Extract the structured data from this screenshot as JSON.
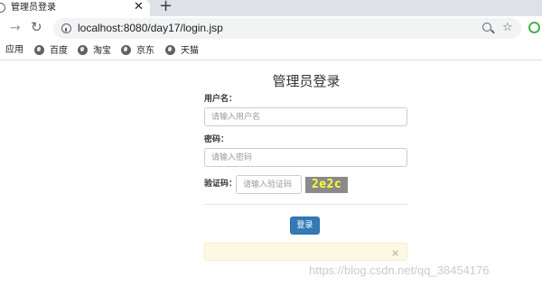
{
  "browser": {
    "tab_title": "管理员登录",
    "tab_close": "✕",
    "new_tab": "+",
    "forward_glyph": "→",
    "reload_glyph": "↻",
    "star_glyph": "☆",
    "url": "localhost:8080/day17/login.jsp",
    "bookmarks": [
      {
        "label": "应用",
        "icon": ""
      },
      {
        "label": "百度",
        "icon": "globe-icon"
      },
      {
        "label": "淘宝",
        "icon": "globe-icon"
      },
      {
        "label": "京东",
        "icon": "globe-icon"
      },
      {
        "label": "天猫",
        "icon": "globe-icon"
      }
    ],
    "extension_color": "#4caf50"
  },
  "login": {
    "title": "管理员登录",
    "username_label": "用户名：",
    "username_placeholder": "请输入用户名",
    "password_label": "密码：",
    "password_placeholder": "请输入密码",
    "captcha_label": "验证码：",
    "captcha_placeholder": "请输入验证码",
    "captcha_text": "2e2c",
    "submit_label": "登录",
    "alert_close": "×",
    "button_color": "#337ab7",
    "alert_color": "#fcf8e3"
  },
  "watermark": "https://blog.csdn.net/qq_38454176"
}
